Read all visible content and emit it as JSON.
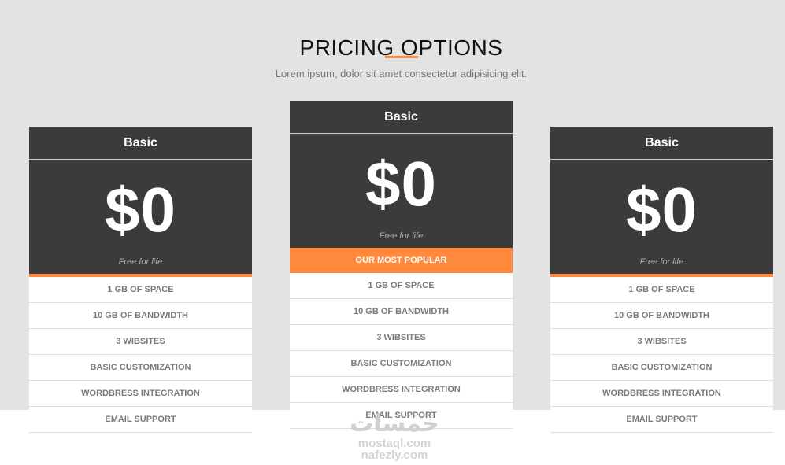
{
  "header": {
    "title": "PRICING OPTIONS",
    "subtitle": "Lorem ipsum, dolor sit amet consectetur adipisicing elit.",
    "accent_color": "#ff8a3d"
  },
  "plans": [
    {
      "name": "Basic",
      "price": "$0",
      "note": "Free for life",
      "features": [
        "1 GB OF SPACE",
        "10 GB OF BANDWIDTH",
        "3 WIBSITES",
        "BASIC CUSTOMIZATION",
        "WORDBRESS INTEGRATION",
        "EMAIL SUPPORT"
      ]
    },
    {
      "name": "Basic",
      "price": "$0",
      "note": "Free for life",
      "badge": "OUR MOST POPULAR",
      "features": [
        "1 GB OF SPACE",
        "10 GB OF BANDWIDTH",
        "3 WIBSITES",
        "BASIC CUSTOMIZATION",
        "WORDBRESS INTEGRATION",
        "EMAIL SUPPORT"
      ]
    },
    {
      "name": "Basic",
      "price": "$0",
      "note": "Free for life",
      "features": [
        "1 GB OF SPACE",
        "10 GB OF BANDWIDTH",
        "3 WIBSITES",
        "BASIC CUSTOMIZATION",
        "WORDBRESS INTEGRATION",
        "EMAIL SUPPORT"
      ]
    }
  ],
  "watermark": {
    "logo": "خمسات",
    "line1": "mostaql.com",
    "line2": "nafezly.com"
  }
}
